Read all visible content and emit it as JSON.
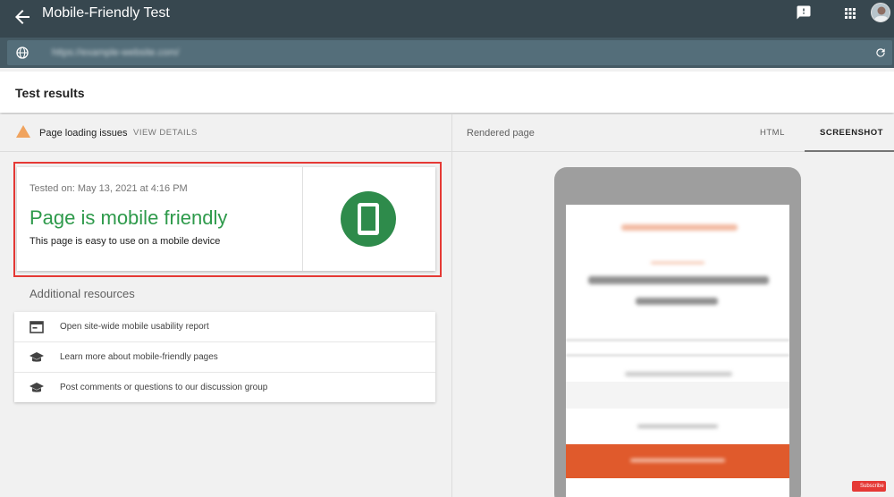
{
  "appbar": {
    "title": "Mobile-Friendly Test",
    "icons": [
      "arrow-back-icon",
      "feedback-icon",
      "apps-grid-icon",
      "account-avatar"
    ]
  },
  "urlbar": {
    "url": "https://example-website.com/",
    "icons": [
      "globe-icon",
      "refresh-icon"
    ]
  },
  "results": {
    "title": "Test results"
  },
  "issues": {
    "label": "Page loading issues",
    "view_details": "VIEW DETAILS",
    "icon": "warning-icon"
  },
  "result_card": {
    "tested_on": "Tested on: May 13, 2021 at 4:16 PM",
    "verdict": "Page is mobile friendly",
    "subtitle": "This page is easy to use on a mobile device",
    "icon": "smartphone-icon"
  },
  "resources": {
    "title": "Additional resources",
    "items": [
      {
        "label": "Open site-wide mobile usability report",
        "icon": "report-icon"
      },
      {
        "label": "Learn more about mobile-friendly pages",
        "icon": "school-icon"
      },
      {
        "label": "Post comments or questions to our discussion group",
        "icon": "school-icon"
      }
    ]
  },
  "rendered": {
    "title": "Rendered page",
    "tabs": [
      "HTML",
      "SCREENSHOT"
    ],
    "active_tab": "SCREENSHOT"
  },
  "badge": {
    "label": "Subscribe"
  },
  "colors": {
    "appbar": "#37474f",
    "urlbar": "#455a64",
    "verdict_green": "#2e9a4b",
    "highlight_red": "#e53935",
    "warning_orange": "#f0a35e",
    "screenshot_orange": "#e05a2c"
  }
}
